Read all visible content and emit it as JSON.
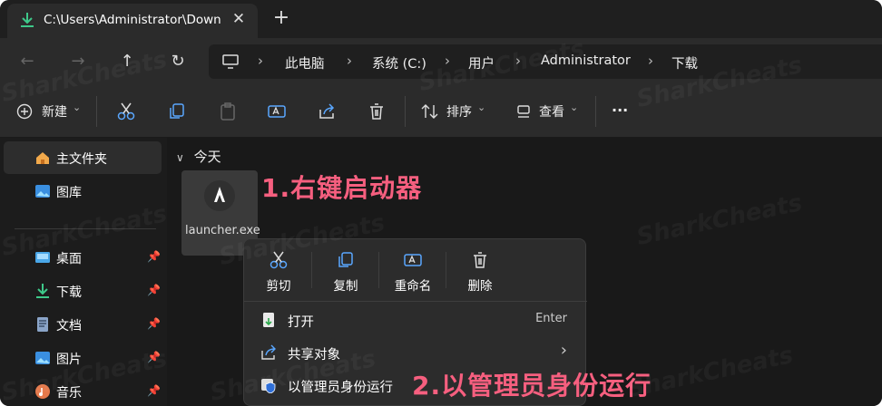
{
  "tab": {
    "title": "C:\\Users\\Administrator\\Downl",
    "close": "✕",
    "new": "+"
  },
  "nav": {
    "back": "←",
    "forward": "→",
    "up": "↑",
    "refresh": "↻"
  },
  "breadcrumb": [
    "此电脑",
    "系统 (C:)",
    "用户",
    "Administrator",
    "下载"
  ],
  "toolbar": {
    "new_label": "新建",
    "sort_label": "排序",
    "view_label": "查看",
    "more": "···"
  },
  "sidebar": {
    "items": [
      {
        "label": "主文件夹",
        "icon": "home-icon",
        "selected": true
      },
      {
        "label": "图库",
        "icon": "gallery-icon"
      },
      {
        "label": "桌面",
        "icon": "desktop-icon",
        "pinned": true
      },
      {
        "label": "下载",
        "icon": "download-icon",
        "pinned": true
      },
      {
        "label": "文档",
        "icon": "documents-icon",
        "pinned": true
      },
      {
        "label": "图片",
        "icon": "pictures-icon",
        "pinned": true
      },
      {
        "label": "音乐",
        "icon": "music-icon",
        "pinned": true
      }
    ]
  },
  "main": {
    "group": "今天",
    "file": {
      "name": "launcher.exe"
    }
  },
  "context_menu": {
    "actions": [
      {
        "label": "剪切",
        "icon": "cut-icon"
      },
      {
        "label": "复制",
        "icon": "copy-icon"
      },
      {
        "label": "重命名",
        "icon": "rename-icon"
      },
      {
        "label": "删除",
        "icon": "delete-icon"
      }
    ],
    "items": [
      {
        "label": "打开",
        "shortcut": "Enter",
        "icon": "open-icon"
      },
      {
        "label": "共享对象",
        "submenu": "›",
        "icon": "share-icon"
      },
      {
        "label": "以管理员身份运行",
        "icon": "admin-shield-icon"
      }
    ]
  },
  "annotations": {
    "step1": "1.右键启动器",
    "step2": "2.以管理员身份运行"
  },
  "watermark": "SharkCheats",
  "colors": {
    "accent": "#f65f7f",
    "download_green": "#3ec98a",
    "background": "#1c1c1c"
  }
}
